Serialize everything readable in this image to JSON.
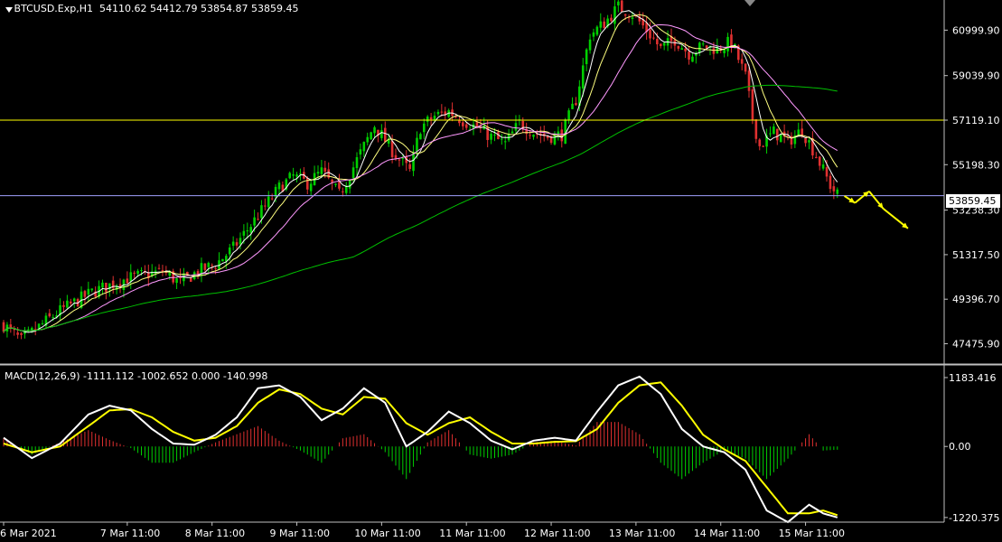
{
  "header": {
    "symbol": "BTCUSD.Exp,H1",
    "ohlc": "54110.62 54412.79 53854.87 53859.45"
  },
  "macd_header": {
    "label": "MACD(12,26,9) -1111.112 -1002.652 0.000 -140.998"
  },
  "current_price_label": "53859.45",
  "colors": {
    "bull": "#00d000",
    "bear": "#e03030",
    "sma_fast": "#ffffff",
    "sma_mid": "#ffff80",
    "sma_slow": "#ff99ff",
    "sma_long": "#00c000",
    "resistance": "#ffff00",
    "current": "#a0a0ff",
    "macd": "#ffffff",
    "signal": "#ffff00",
    "arrow": "#ffff00"
  },
  "chart_data": [
    {
      "type": "candlestick",
      "title": "BTCUSD.Exp,H1",
      "ylim": [
        46600,
        62300
      ],
      "price_axis_labels": [
        "60999.90",
        "59039.90",
        "57119.10",
        "55198.30",
        "53238.30",
        "51317.50",
        "49396.70",
        "47475.90"
      ],
      "price_axis_values": [
        60999.9,
        59039.9,
        57119.1,
        55198.3,
        53238.3,
        51317.5,
        49396.7,
        47475.9
      ],
      "time_axis_labels": [
        "6 Mar 2021",
        "7 Mar 11:00",
        "8 Mar 11:00",
        "9 Mar 11:00",
        "10 Mar 11:00",
        "11 Mar 11:00",
        "12 Mar 11:00",
        "13 Mar 11:00",
        "14 Mar 11:00",
        "15 Mar 11:00"
      ],
      "time_axis_index": [
        0,
        35,
        59,
        83,
        107,
        131,
        155,
        179,
        203,
        227
      ],
      "trend_points_index": [
        0,
        5,
        15,
        25,
        35,
        45,
        50,
        55,
        60,
        65,
        70,
        78,
        82,
        86,
        90,
        95,
        100,
        105,
        110,
        115,
        118,
        122,
        126,
        130,
        134,
        138,
        142,
        146,
        150,
        154,
        158,
        162,
        166,
        170,
        174,
        178,
        182,
        186,
        190,
        194,
        198,
        202,
        206,
        210,
        212,
        214,
        218,
        222,
        226,
        230,
        234,
        236
      ],
      "trend_points_close": [
        48300,
        47600,
        48800,
        49700,
        50300,
        50600,
        50100,
        50600,
        50900,
        51600,
        52600,
        54200,
        54700,
        54400,
        54900,
        53900,
        55400,
        56900,
        55800,
        54900,
        56800,
        57300,
        57500,
        57100,
        56800,
        56400,
        56100,
        57000,
        56600,
        56400,
        56500,
        58000,
        60800,
        61300,
        62000,
        61700,
        61000,
        60200,
        60600,
        60000,
        60300,
        60200,
        60500,
        59000,
        57200,
        56000,
        56600,
        56200,
        56700,
        55600,
        54300,
        53900
      ],
      "resistance_level": 57119.1,
      "current_price": 53859.45,
      "projection_arrow": [
        [
          238,
          53850
        ],
        [
          241,
          53550
        ],
        [
          245,
          54050
        ],
        [
          249,
          53300
        ],
        [
          256,
          52450
        ]
      ]
    },
    {
      "type": "bar",
      "title": "MACD(12,26,9)",
      "ylim": [
        -1300,
        1400
      ],
      "axis_labels": [
        "1183.416",
        "0.00",
        "-1220.375"
      ],
      "axis_values": [
        1183.416,
        0,
        -1220.375
      ],
      "macd_line_index": [
        0,
        8,
        16,
        24,
        30,
        36,
        42,
        48,
        54,
        60,
        66,
        72,
        78,
        84,
        90,
        96,
        102,
        108,
        114,
        120,
        126,
        132,
        138,
        144,
        150,
        156,
        162,
        168,
        174,
        180,
        186,
        192,
        198,
        204,
        210,
        216,
        222,
        228,
        232,
        236
      ],
      "macd_line": [
        150,
        -200,
        50,
        550,
        700,
        620,
        300,
        50,
        30,
        200,
        500,
        1000,
        1050,
        850,
        450,
        650,
        1000,
        750,
        0,
        250,
        600,
        400,
        100,
        -50,
        100,
        150,
        100,
        600,
        1050,
        1200,
        900,
        300,
        0,
        -100,
        -400,
        -1100,
        -1300,
        -1000,
        -1150,
        -1220
      ],
      "signal_line": [
        50,
        -100,
        0,
        350,
        620,
        640,
        500,
        250,
        100,
        150,
        350,
        750,
        980,
        900,
        650,
        550,
        850,
        820,
        400,
        200,
        400,
        500,
        250,
        50,
        50,
        80,
        90,
        300,
        750,
        1050,
        1100,
        700,
        200,
        -50,
        -250,
        -700,
        -1150,
        -1150,
        -1100,
        -1180
      ]
    }
  ]
}
